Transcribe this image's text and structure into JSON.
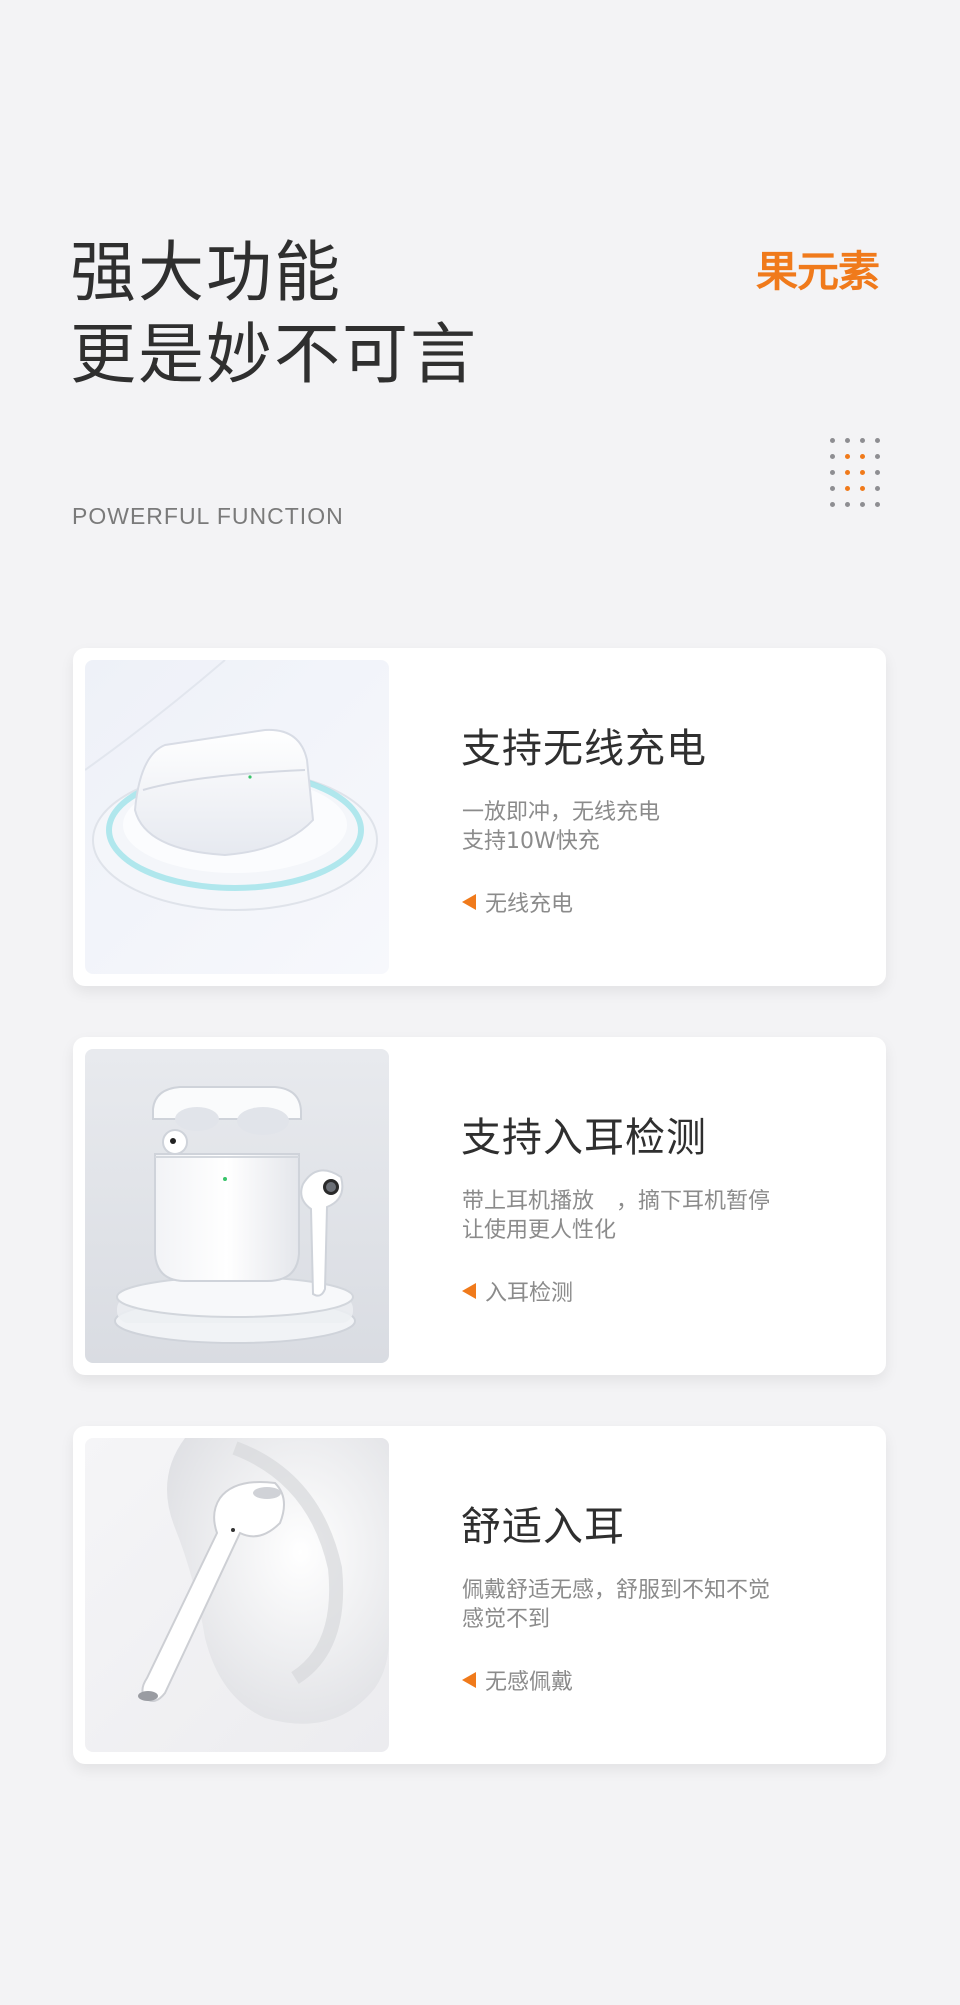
{
  "headline": {
    "line1": "强大功能",
    "line2": "更是妙不可言"
  },
  "brand": {
    "logo_text": "果元素",
    "color": "#f07a1b"
  },
  "subtitle": "POWERFUL FUNCTION",
  "features": [
    {
      "title": "支持无线充电",
      "desc_line1": "一放即冲，无线充电",
      "desc_line2": "支持10W快充",
      "tag": "无线充电",
      "image": "earbuds-case-on-wireless-charger"
    },
    {
      "title": "支持入耳检测",
      "desc_line1": "带上耳机播放　，摘下耳机暂停",
      "desc_line2": "让使用更人性化",
      "tag": "入耳检测",
      "image": "open-earbuds-case-on-stand"
    },
    {
      "title": "舒适入耳",
      "desc_line1": "佩戴舒适无感，舒服到不知不觉",
      "desc_line2": "感觉不到",
      "tag": "无感佩戴",
      "image": "earbud-in-ear"
    }
  ],
  "accent": "#f07a1b"
}
